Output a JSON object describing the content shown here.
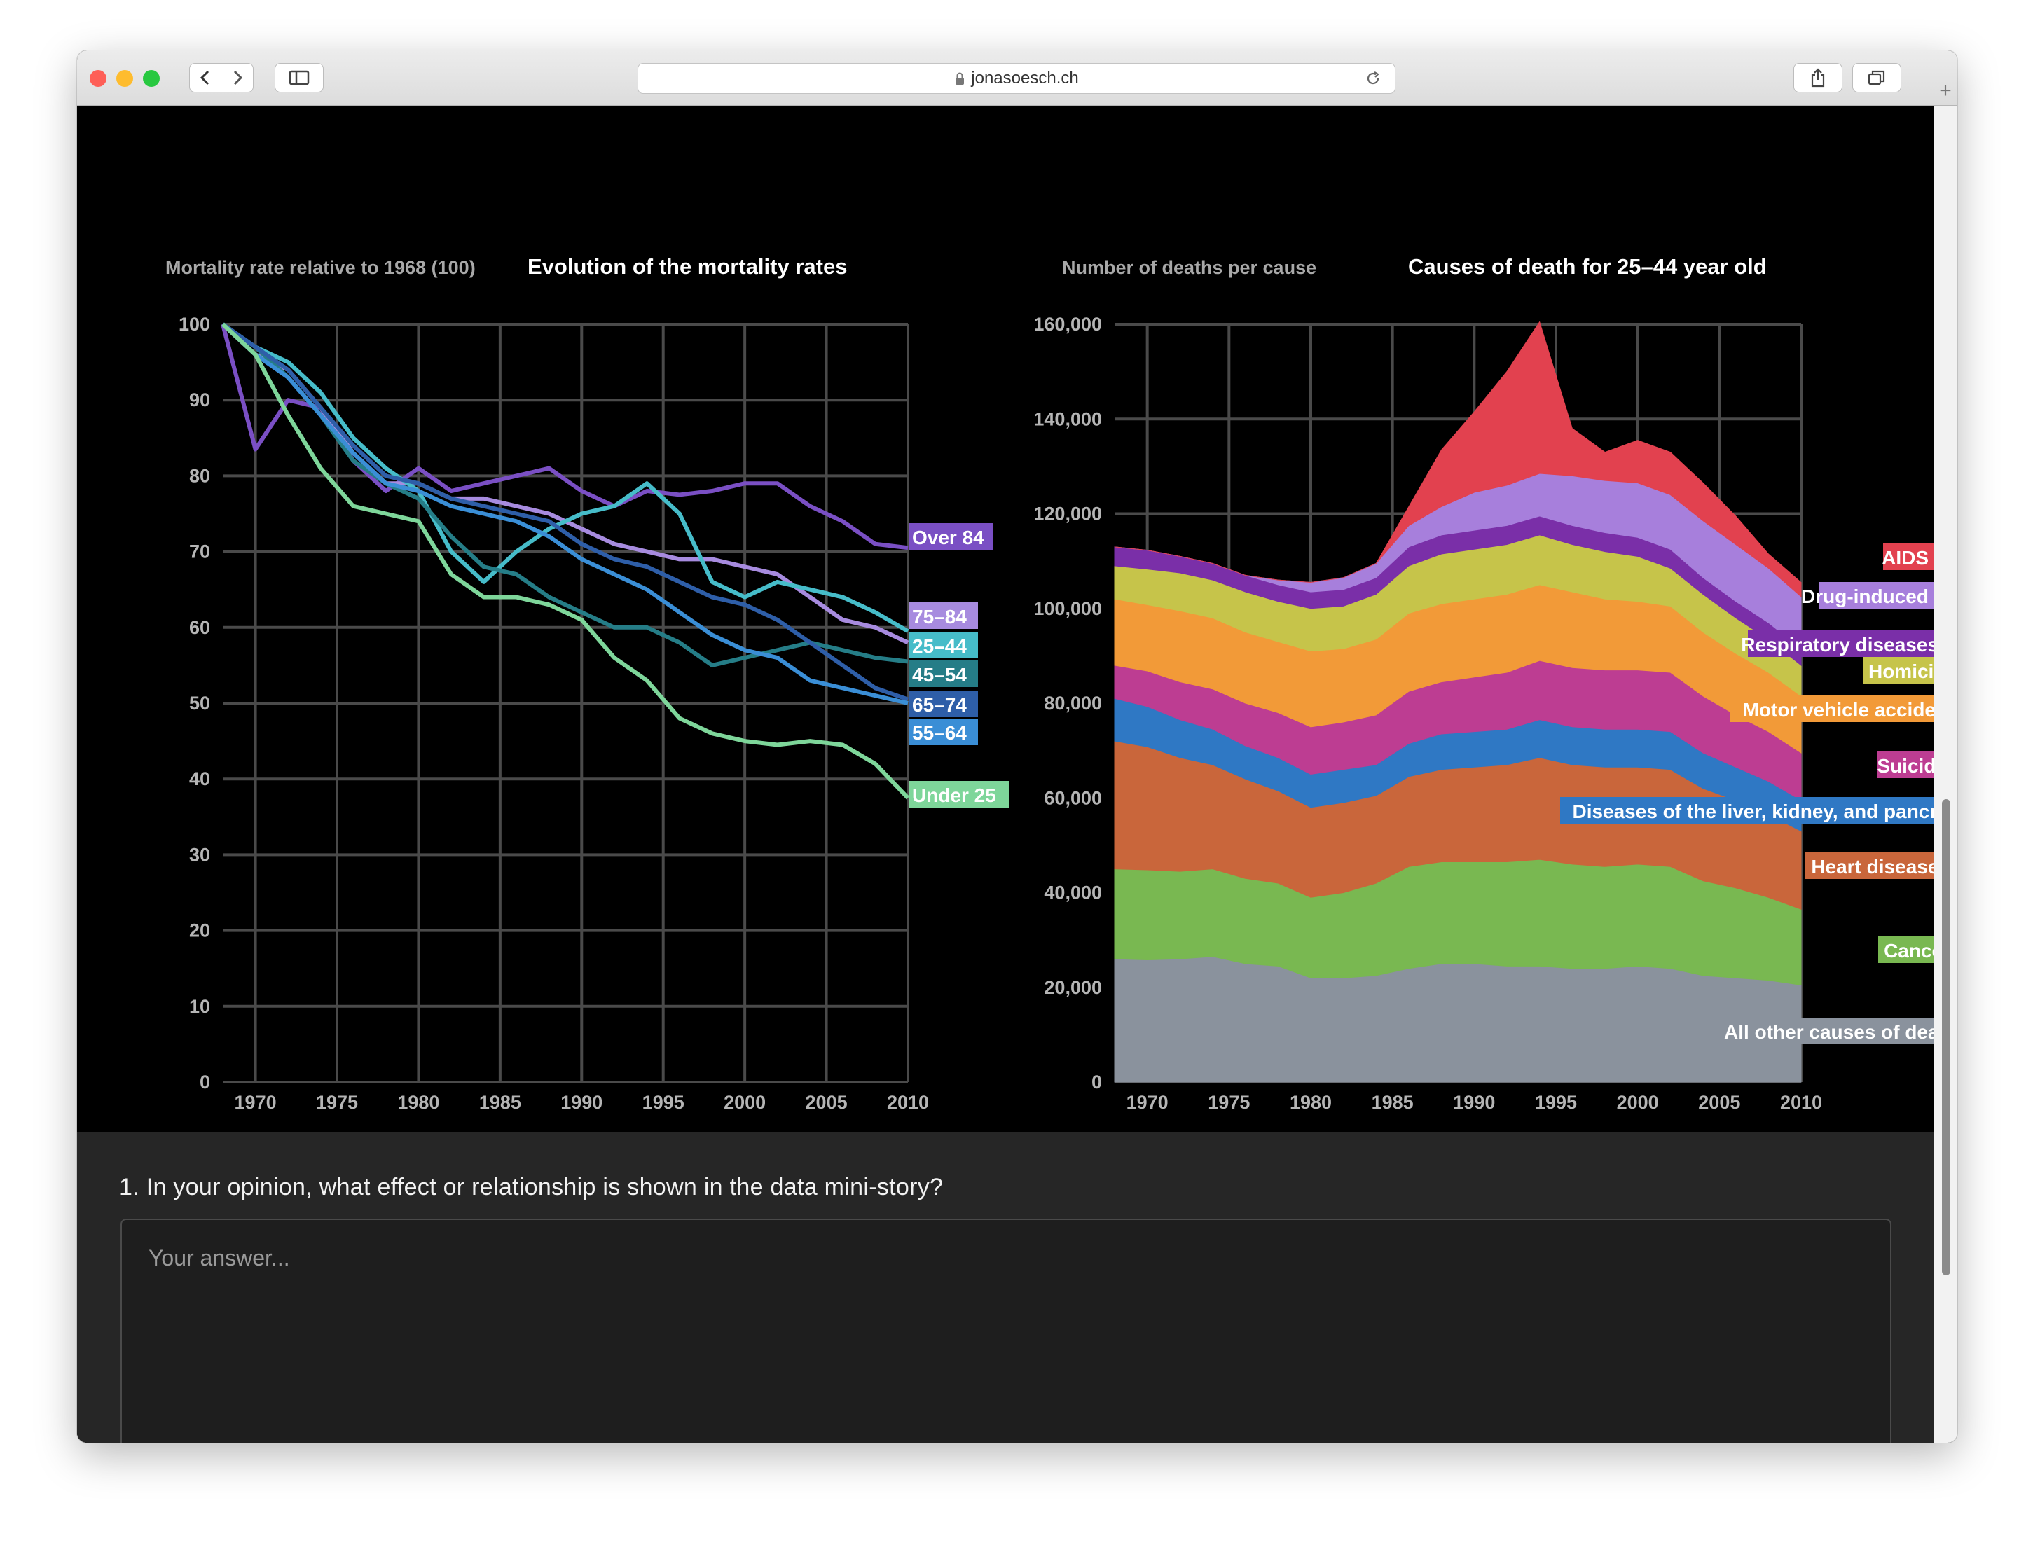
{
  "browser": {
    "url": "jonasoesch.ch",
    "colors": {
      "close": "#fe5f57",
      "minimize": "#febc2e",
      "zoom": "#28c840"
    }
  },
  "question": {
    "text": "1. In your opinion, what effect or relationship is shown in the data mini-story?",
    "placeholder": "Your answer..."
  },
  "chart_data": [
    {
      "type": "line",
      "title": "Evolution of the mortality rates",
      "ylabel": "Mortality rate relative to 1968 (100)",
      "xlabel": "",
      "xlim": [
        1968,
        2010
      ],
      "ylim": [
        0,
        100
      ],
      "xticks": [
        "1970",
        "1975",
        "1980",
        "1985",
        "1990",
        "1995",
        "2000",
        "2005",
        "2010"
      ],
      "yticks": [
        "0",
        "10",
        "20",
        "30",
        "40",
        "50",
        "60",
        "70",
        "80",
        "90",
        "100"
      ],
      "grid": true,
      "legend": "labels at line ends (right)",
      "x": [
        1968,
        1970,
        1972,
        1974,
        1976,
        1978,
        1980,
        1982,
        1984,
        1986,
        1988,
        1990,
        1992,
        1994,
        1996,
        1998,
        2000,
        2002,
        2004,
        2006,
        2008,
        2010
      ],
      "series": [
        {
          "name": "Over 84",
          "color": "#7a4fc4",
          "values": [
            100,
            83.5,
            90,
            89,
            82,
            78,
            81,
            78,
            79,
            80,
            81,
            78,
            76,
            78,
            77.5,
            78,
            79,
            79,
            76,
            74,
            71,
            70.5
          ]
        },
        {
          "name": "75–84",
          "color": "#a78bdf",
          "values": [
            100,
            96,
            94,
            89,
            83,
            79,
            79,
            77,
            77,
            76,
            75,
            73,
            71,
            70,
            69,
            69,
            68,
            67,
            64,
            61,
            60,
            58
          ]
        },
        {
          "name": "25–44",
          "color": "#46bcc9",
          "values": [
            100,
            97,
            95,
            91,
            85,
            81,
            78,
            70,
            66,
            70,
            73,
            75,
            76,
            79,
            75,
            66,
            64,
            66,
            65,
            64,
            62,
            59.5
          ]
        },
        {
          "name": "45–54",
          "color": "#257d87",
          "values": [
            100,
            97,
            93,
            88,
            82,
            79,
            77,
            72,
            68,
            67,
            64,
            62,
            60,
            60,
            58,
            55,
            56,
            57,
            58,
            57,
            56,
            55.5
          ]
        },
        {
          "name": "65–74",
          "color": "#2e5ea8",
          "values": [
            100,
            97,
            94,
            89,
            84,
            80,
            79,
            77,
            76,
            75,
            74,
            71,
            69,
            68,
            66,
            64,
            63,
            61,
            58,
            55,
            52,
            50.5
          ]
        },
        {
          "name": "55–64",
          "color": "#3a8ed6",
          "values": [
            100,
            96,
            93,
            88,
            83,
            79,
            78,
            76,
            75,
            74,
            72,
            69,
            67,
            65,
            62,
            59,
            57,
            56,
            53,
            52,
            51,
            50
          ]
        },
        {
          "name": "Under 25",
          "color": "#7ed69a",
          "values": [
            100,
            96,
            88,
            81,
            76,
            75,
            74,
            67,
            64,
            64,
            63,
            61,
            56,
            53,
            48,
            46,
            45,
            44.5,
            45,
            44.5,
            42,
            37.5
          ]
        }
      ]
    },
    {
      "type": "area",
      "stacked": true,
      "title": "Causes of death for 25–44 year old",
      "ylabel": "Number of deaths per cause",
      "xlabel": "",
      "xlim": [
        1968,
        2010
      ],
      "ylim": [
        0,
        160000
      ],
      "xticks": [
        "1970",
        "1975",
        "1980",
        "1985",
        "1990",
        "1995",
        "2000",
        "2005",
        "2010"
      ],
      "yticks": [
        "0",
        "20,000",
        "40,000",
        "60,000",
        "80,000",
        "100,000",
        "120,000",
        "140,000",
        "160,000"
      ],
      "grid": true,
      "legend": "labels at series ends (right)",
      "x": [
        1968,
        1970,
        1972,
        1974,
        1976,
        1978,
        1980,
        1982,
        1984,
        1986,
        1988,
        1990,
        1992,
        1994,
        1996,
        1998,
        2000,
        2002,
        2004,
        2006,
        2008,
        2010
      ],
      "series": [
        {
          "name": "All other causes of death",
          "color": "#8a929d",
          "values": [
            26000,
            25800,
            26000,
            26500,
            25000,
            24500,
            22000,
            22000,
            22500,
            24000,
            25000,
            25000,
            24500,
            24500,
            24000,
            24000,
            24500,
            24000,
            22500,
            22000,
            21500,
            20500
          ]
        },
        {
          "name": "Cancer",
          "color": "#79b851",
          "values": [
            19000,
            19000,
            18500,
            18500,
            18000,
            17500,
            17000,
            18000,
            19500,
            21500,
            21500,
            21500,
            22000,
            22500,
            22000,
            21500,
            21500,
            21500,
            20000,
            19000,
            17500,
            16000
          ]
        },
        {
          "name": "Heart diseases",
          "color": "#c9663b",
          "values": [
            27000,
            26000,
            24000,
            22000,
            21000,
            19500,
            19000,
            19000,
            18500,
            19000,
            19500,
            20000,
            20500,
            21500,
            21000,
            21000,
            20500,
            20500,
            19500,
            18500,
            17500,
            16500
          ]
        },
        {
          "name": "Diseases of the liver, kidney, and pancreas",
          "color": "#2f78c4",
          "values": [
            9000,
            8500,
            8000,
            7500,
            7000,
            7000,
            7000,
            7000,
            6500,
            7000,
            7500,
            7500,
            7500,
            8000,
            8000,
            8000,
            8000,
            8000,
            7500,
            7000,
            7000,
            6500
          ]
        },
        {
          "name": "Suicide",
          "color": "#bd3d92",
          "values": [
            7000,
            7500,
            8000,
            8500,
            9000,
            9500,
            10000,
            10000,
            10500,
            11000,
            11000,
            11500,
            12000,
            12500,
            12500,
            12500,
            12500,
            12500,
            12000,
            11000,
            10500,
            10000
          ]
        },
        {
          "name": "Motor vehicle accidents",
          "color": "#f29a38",
          "values": [
            14000,
            14000,
            15000,
            15000,
            15000,
            15000,
            16000,
            15500,
            16000,
            16500,
            16500,
            16500,
            16500,
            16000,
            16000,
            15000,
            14500,
            14000,
            13500,
            13000,
            12500,
            12000
          ]
        },
        {
          "name": "Homicide",
          "color": "#c6c44a",
          "values": [
            7000,
            7500,
            8000,
            8000,
            8500,
            8500,
            9000,
            9000,
            9500,
            10000,
            10500,
            10500,
            10500,
            10500,
            10000,
            10000,
            9500,
            8000,
            8000,
            7500,
            7000,
            6500
          ]
        },
        {
          "name": "Respiratory diseases",
          "color": "#7a2fa8",
          "values": [
            4000,
            4000,
            3500,
            3500,
            3500,
            3500,
            3500,
            3500,
            3500,
            4000,
            4000,
            4000,
            4000,
            4000,
            4000,
            4000,
            4000,
            4000,
            3500,
            3500,
            3500,
            3500
          ]
        },
        {
          "name": "Drug-induced",
          "color": "#a77fdc",
          "values": [
            0,
            0,
            0,
            0,
            0,
            1000,
            2000,
            2500,
            3000,
            4500,
            6000,
            8000,
            8500,
            9000,
            10500,
            11000,
            11500,
            11500,
            12000,
            12000,
            11500,
            11000
          ]
        },
        {
          "name": "AIDS",
          "color": "#e2414f",
          "values": [
            0,
            0,
            0,
            0,
            0,
            0,
            0,
            0,
            0,
            4000,
            12000,
            17000,
            24000,
            32000,
            10000,
            6000,
            9000,
            9000,
            8000,
            6000,
            3000,
            3000
          ]
        }
      ]
    }
  ]
}
